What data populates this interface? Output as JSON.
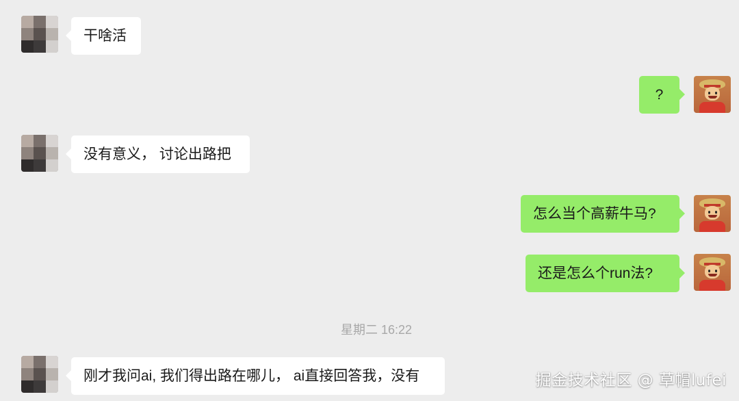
{
  "messages": [
    {
      "sender": "other",
      "text": "干啥活"
    },
    {
      "sender": "me",
      "text": "?"
    },
    {
      "sender": "other",
      "text": "没有意义， 讨论出路把"
    },
    {
      "sender": "me",
      "text": "怎么当个高薪牛马?"
    },
    {
      "sender": "me",
      "text": "还是怎么个run法?"
    },
    {
      "sender": "other",
      "text": "刚才我问ai, 我们得出路在哪儿， ai直接回答我，没有"
    }
  ],
  "timestamp": "星期二 16:22",
  "watermark": "掘金技术社区 @ 草帽lufei",
  "colors": {
    "background": "#ededed",
    "incoming_bubble": "#ffffff",
    "outgoing_bubble": "#95ec69",
    "timestamp_text": "#a8a8a8"
  },
  "icons": {
    "other_avatar": "pixelated-avatar-icon",
    "my_avatar": "straw-hat-cartoon-avatar-icon"
  }
}
